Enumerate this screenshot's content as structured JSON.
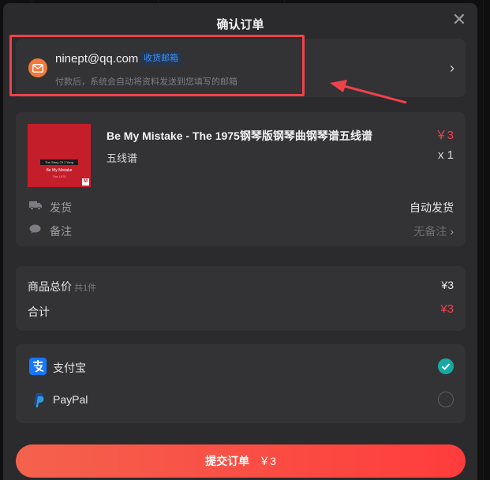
{
  "dialog": {
    "title": "确认订单"
  },
  "email": {
    "address": "ninept@qq.com",
    "badge": "收货邮箱",
    "hint": "付款后，系统会自动将资料发送到您填写的邮箱"
  },
  "product": {
    "name": "Be My Mistake - The 1975钢琴版钢琴曲钢琴谱五线谱",
    "price": "￥3",
    "type": "五线谱",
    "quantity": "x 1",
    "cover": {
      "title": "Be My Mistake",
      "banner": "The Story Of J.Yang",
      "sub": "The 1975"
    },
    "shipping_label": "发货",
    "shipping_value": "自动发货",
    "note_label": "备注",
    "note_value": "无备注"
  },
  "summary": {
    "total_label": "商品总价",
    "total_count": "共1件",
    "total_value": "¥3",
    "grand_label": "合计",
    "grand_value": "¥3"
  },
  "payment": {
    "methods": [
      {
        "name": "支付宝",
        "selected": true
      },
      {
        "name": "PayPal",
        "selected": false
      }
    ]
  },
  "submit": {
    "label": "提交订单",
    "amount": "￥3"
  },
  "colors": {
    "accent_red": "#f0414a",
    "alipay_blue": "#1677ff",
    "check_teal": "#19a9a4",
    "email_orange": "#f07a3a"
  }
}
